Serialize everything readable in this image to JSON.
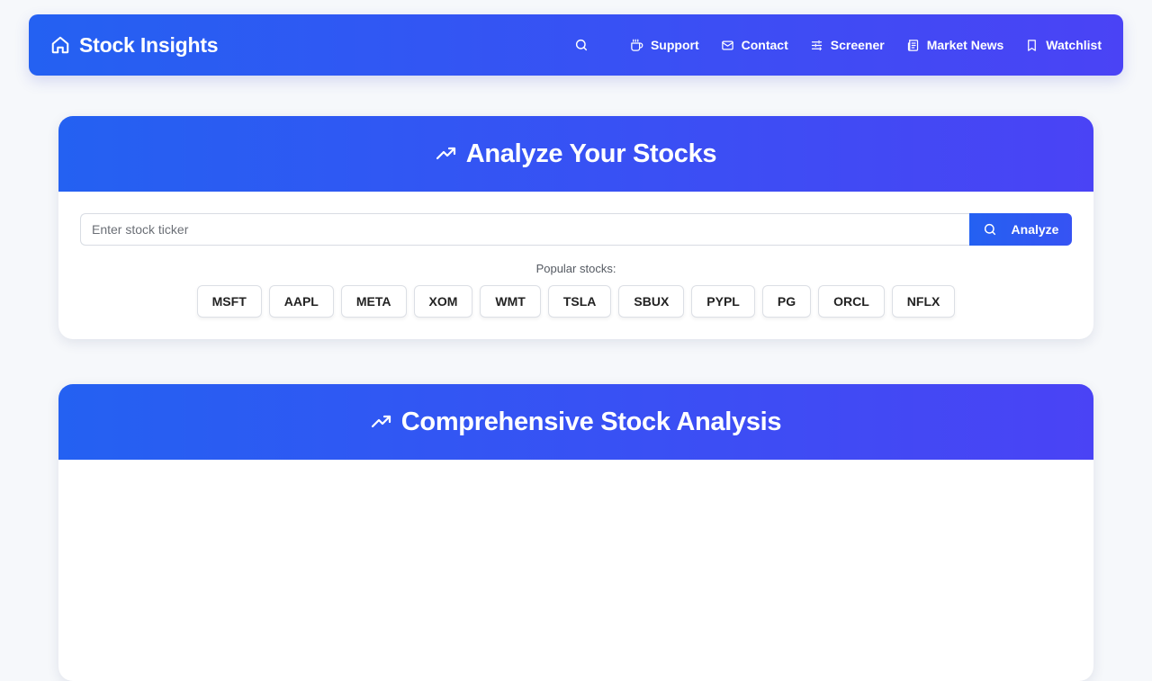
{
  "nav": {
    "brand": "Stock Insights",
    "brand_icon": "home-icon",
    "search_icon": "search-icon",
    "items": [
      {
        "label": "Support",
        "icon": "coffee-icon"
      },
      {
        "label": "Contact",
        "icon": "mail-icon"
      },
      {
        "label": "Screener",
        "icon": "sliders-icon"
      },
      {
        "label": "Market News",
        "icon": "newspaper-icon"
      },
      {
        "label": "Watchlist",
        "icon": "bookmark-icon"
      }
    ]
  },
  "analyze": {
    "title": "Analyze Your Stocks",
    "title_icon": "trending-up-icon",
    "input_placeholder": "Enter stock ticker",
    "input_value": "",
    "button_label": "Analyze",
    "popular_label": "Popular stocks:",
    "tickers": [
      "MSFT",
      "AAPL",
      "META",
      "XOM",
      "WMT",
      "TSLA",
      "SBUX",
      "PYPL",
      "PG",
      "ORCL",
      "NFLX"
    ]
  },
  "analysis": {
    "title": "Comprehensive Stock Analysis",
    "title_icon": "trending-up-icon"
  },
  "colors": {
    "accent_start": "#2461f2",
    "accent_end": "#4a43f5",
    "background": "#f6f8fb"
  }
}
